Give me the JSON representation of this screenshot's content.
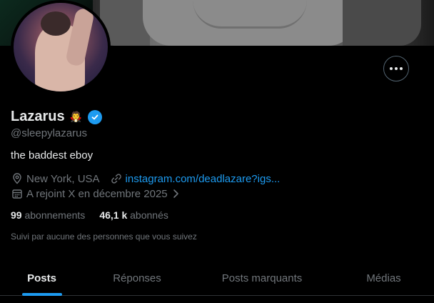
{
  "profile": {
    "name": "Lazarus",
    "name_emoji": "🧛",
    "handle": "@sleepylazarus",
    "bio": "the baddest eboy",
    "location": "New York, USA",
    "link": "instagram.com/deadlazare?igs...",
    "joined": "A rejoint X en décembre 2025",
    "following_count": "99",
    "following_label": "abonnements",
    "followers_count": "46,1 k",
    "followers_label": "abonnés",
    "followed_by_note": "Suivi par aucune des personnes que vous suivez"
  },
  "tabs": [
    {
      "label": "Posts"
    },
    {
      "label": "Réponses"
    },
    {
      "label": "Posts marquants"
    },
    {
      "label": "Médias"
    }
  ],
  "icons": {
    "more": "more-horizontal-icon",
    "verified": "verified-badge-icon",
    "location": "location-pin-icon",
    "link": "link-icon",
    "calendar": "calendar-icon",
    "chevron": "chevron-right-icon"
  },
  "colors": {
    "accent": "#1d9bf0",
    "text": "#e7e9ea",
    "muted": "#71767b",
    "background": "#000000"
  }
}
